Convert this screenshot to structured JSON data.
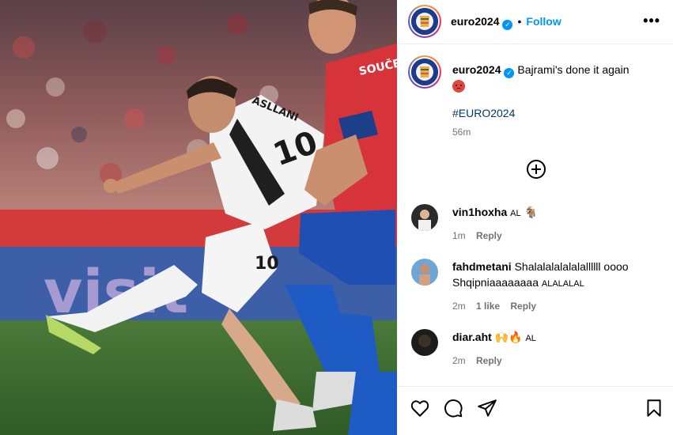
{
  "post": {
    "username": "euro2024",
    "follow_label": "Follow",
    "more_icon": "more-horizontal-icon",
    "caption": "Bajrami's done it again",
    "hashtag": "#EURO2024",
    "time": "56m",
    "colors": {
      "link": "#0095f6",
      "hashtag": "#00376b",
      "muted": "#737373"
    }
  },
  "photo": {
    "jersey_name_back": "SOUČEK",
    "jersey_name_white": "ASLLANI",
    "number_shirt": "10",
    "number_shorts": "10",
    "board_text": "visit"
  },
  "comments": [
    {
      "username": "vin1hoxha",
      "text_small": "AL",
      "emoji": "goat-emoji",
      "time": "1m",
      "reply": "Reply",
      "likes": ""
    },
    {
      "username": "fahdmetani",
      "text": "Shalalalalalalallllll oooo Shqipniaaaaaaaa",
      "text_small": "ALALALAL",
      "time": "2m",
      "likes": "1 like",
      "reply": "Reply"
    },
    {
      "username": "diar.aht",
      "text_small": "AL",
      "emoji": "hands-fire-emoji",
      "time": "2m",
      "reply": "Reply",
      "likes": ""
    }
  ],
  "actions": {
    "like_icon": "heart-icon",
    "comment_icon": "comment-icon",
    "share_icon": "share-icon",
    "save_icon": "bookmark-icon"
  }
}
